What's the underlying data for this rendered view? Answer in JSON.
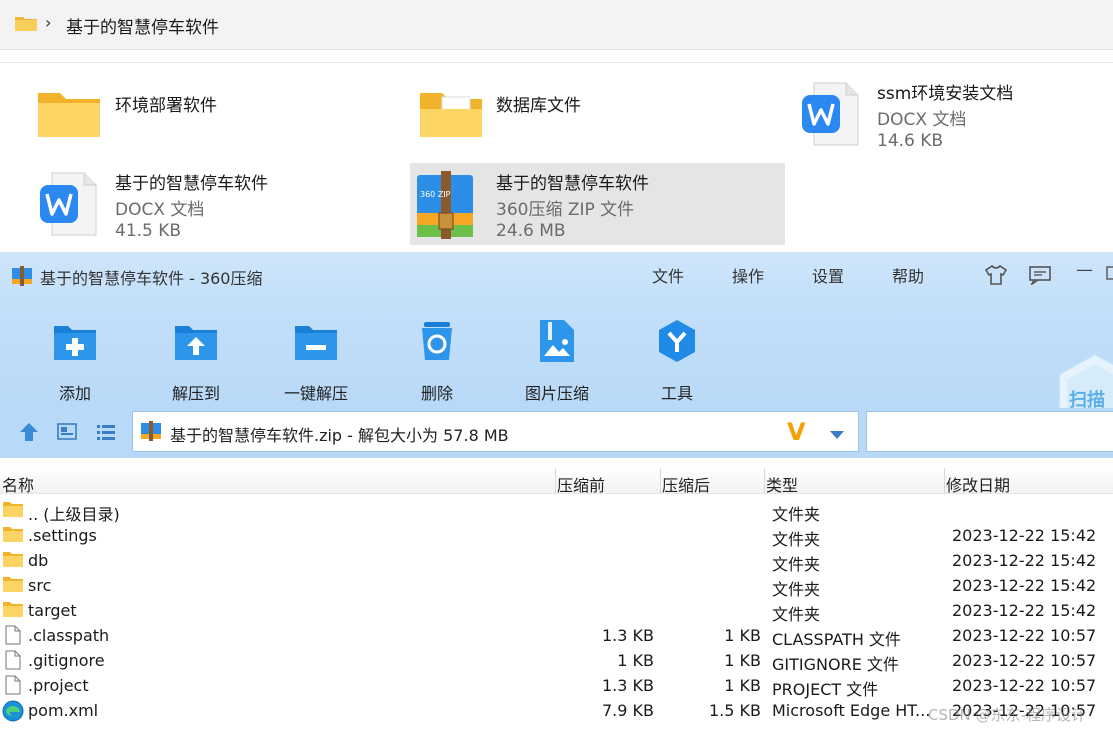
{
  "explorer": {
    "breadcrumb": "基于的智慧停车软件",
    "breadcrumb_sep": "›",
    "items": [
      {
        "name": "环境部署软件",
        "type": "",
        "size": ""
      },
      {
        "name": "数据库文件",
        "type": "",
        "size": ""
      },
      {
        "name": "ssm环境安装文档",
        "type": "DOCX 文档",
        "size": "14.6 KB"
      },
      {
        "name": "基于的智慧停车软件",
        "type": "DOCX 文档",
        "size": "41.5 KB"
      },
      {
        "name": "基于的智慧停车软件",
        "type": "360压缩 ZIP 文件",
        "size": "24.6 MB"
      }
    ]
  },
  "zipwindow": {
    "title": "基于的智慧停车软件 - 360压缩",
    "menu": [
      "文件",
      "操作",
      "设置",
      "帮助"
    ],
    "minimize_glyph": "—",
    "toolbar": [
      "添加",
      "解压到",
      "一键解压",
      "删除",
      "图片压缩",
      "工具"
    ],
    "scan_label": "扫描",
    "zip_icon_label": "360 ZIP",
    "address": "基于的智慧停车软件.zip - 解包大小为 57.8 MB",
    "address_badge": "V",
    "columns": [
      "名称",
      "压缩前",
      "压缩后",
      "类型",
      "修改日期"
    ],
    "rows": [
      {
        "icon": "folder-icon",
        "name": ".. (上级目录)",
        "size": "",
        "packed": "",
        "type": "文件夹",
        "date": ""
      },
      {
        "icon": "folder-icon",
        "name": ".settings",
        "size": "",
        "packed": "",
        "type": "文件夹",
        "date": "2023-12-22 15:42"
      },
      {
        "icon": "folder-icon",
        "name": "db",
        "size": "",
        "packed": "",
        "type": "文件夹",
        "date": "2023-12-22 15:42"
      },
      {
        "icon": "folder-icon",
        "name": "src",
        "size": "",
        "packed": "",
        "type": "文件夹",
        "date": "2023-12-22 15:42"
      },
      {
        "icon": "folder-icon",
        "name": "target",
        "size": "",
        "packed": "",
        "type": "文件夹",
        "date": "2023-12-22 15:42"
      },
      {
        "icon": "file-icon",
        "name": ".classpath",
        "size": "1.3 KB",
        "packed": "1 KB",
        "type": "CLASSPATH 文件",
        "date": "2023-12-22 10:57"
      },
      {
        "icon": "file-icon",
        "name": ".gitignore",
        "size": "1 KB",
        "packed": "1 KB",
        "type": "GITIGNORE 文件",
        "date": "2023-12-22 10:57"
      },
      {
        "icon": "file-icon",
        "name": ".project",
        "size": "1.3 KB",
        "packed": "1 KB",
        "type": "PROJECT 文件",
        "date": "2023-12-22 10:57"
      },
      {
        "icon": "edge-icon",
        "name": "pom.xml",
        "size": "7.9 KB",
        "packed": "1.5 KB",
        "type": "Microsoft Edge HT...",
        "date": "2023-12-22 10:57"
      }
    ]
  },
  "watermark": "CSDN @东东-程序设计",
  "colors": {
    "titlebar": "#cfe6fb",
    "toolbar": "#bcdaf8",
    "accent": "#2a8fe0",
    "folder": "#f8c548",
    "selected": "#e5e5e5"
  }
}
